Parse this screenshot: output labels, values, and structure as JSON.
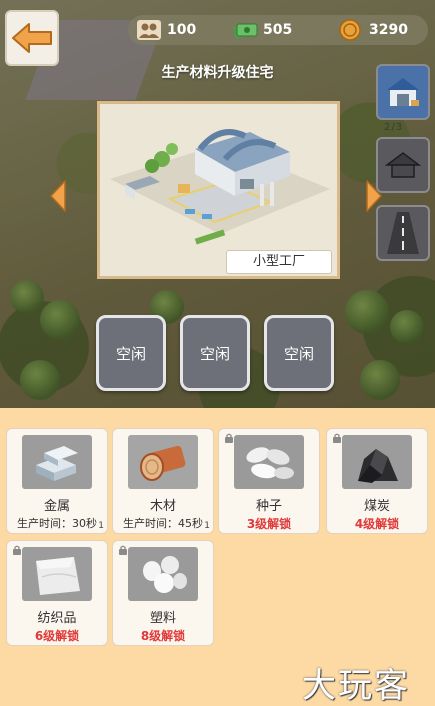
{
  "back_icon": "back-arrow-icon",
  "resources": [
    {
      "icon": "population-icon",
      "value": "100"
    },
    {
      "icon": "cash-icon",
      "value": "505"
    },
    {
      "icon": "coin-icon",
      "value": "3290"
    }
  ],
  "dialog": {
    "title": "生产材料升级住宅",
    "building_name": "小型工厂"
  },
  "side_buttons": [
    "warehouse-icon",
    "house-icon",
    "road-icon"
  ],
  "side_progress": "2/3",
  "slots": [
    {
      "label": "空闲"
    },
    {
      "label": "空闲"
    },
    {
      "label": "空闲"
    }
  ],
  "materials": [
    {
      "name": "金属",
      "sub": "生产时间：30秒",
      "count": "1",
      "locked": false,
      "icon": "metal-ingot-icon"
    },
    {
      "name": "木材",
      "sub": "生产时间：45秒",
      "count": "1",
      "locked": false,
      "icon": "wood-log-icon"
    },
    {
      "name": "种子",
      "sub": "3级解锁",
      "count": "",
      "locked": true,
      "icon": "seeds-icon"
    },
    {
      "name": "煤炭",
      "sub": "4级解锁",
      "count": "",
      "locked": true,
      "icon": "coal-icon"
    },
    {
      "name": "纺织品",
      "sub": "6级解锁",
      "count": "",
      "locked": true,
      "icon": "textile-icon"
    },
    {
      "name": "塑料",
      "sub": "8级解锁",
      "count": "",
      "locked": true,
      "icon": "plastic-icon"
    }
  ],
  "watermark": "大玩客",
  "colors": {
    "panel_bg": "#fdd9a4",
    "locked_text": "#e03a3a",
    "back_arrow": "#f0a34a"
  }
}
